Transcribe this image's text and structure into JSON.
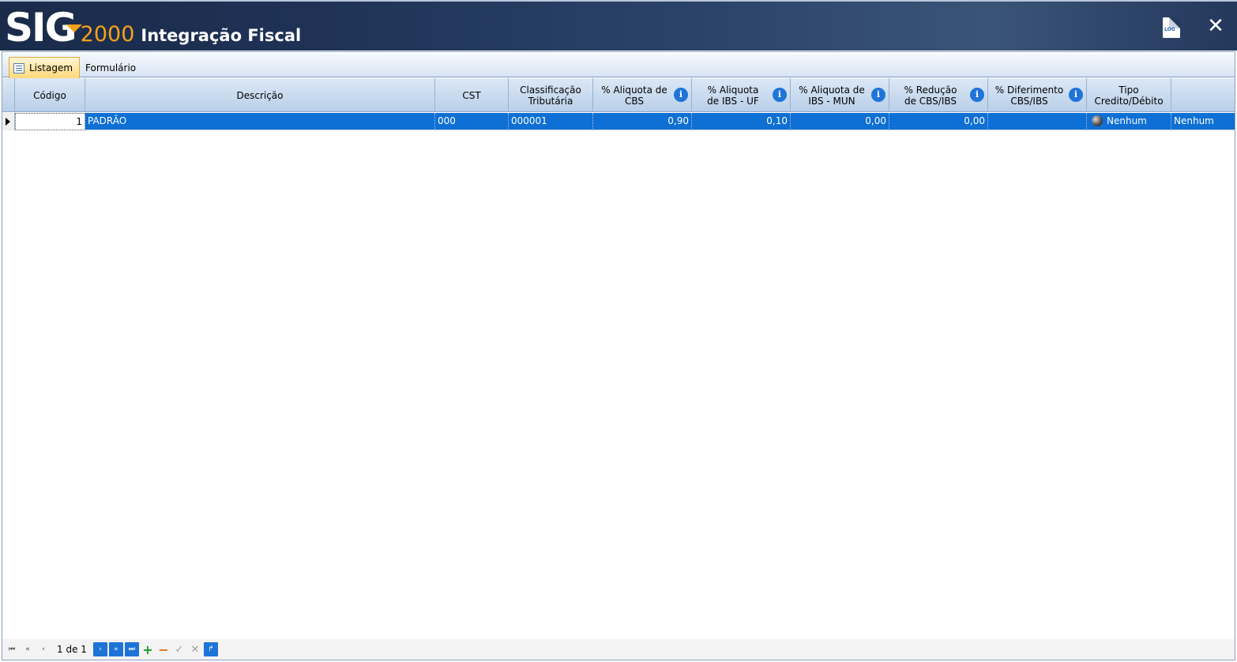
{
  "app": {
    "logo_main": "SIG",
    "logo_number": "2000",
    "title": "Integração Fiscal",
    "log_icon_label": "LOG"
  },
  "tabs": [
    {
      "label": "Listagem",
      "active": true
    },
    {
      "label": "Formulário",
      "active": false
    }
  ],
  "columns": [
    {
      "label": "Código"
    },
    {
      "label": "Descrição"
    },
    {
      "label": "CST"
    },
    {
      "label": "Classificação Tributária"
    },
    {
      "label": "% Aliquota de CBS"
    },
    {
      "label": "% Aliquota de IBS - UF"
    },
    {
      "label": "% Aliquota de IBS - MUN"
    },
    {
      "label": "% Redução de CBS/IBS"
    },
    {
      "label": "% Diferimento CBS/IBS"
    },
    {
      "label": "Tipo Credito/Débito"
    }
  ],
  "rows": [
    {
      "codigo": "1",
      "descricao": "PADRÃO",
      "cst": "000",
      "classificacao": "000001",
      "aliquota_cbs": "0,90",
      "aliquota_ibs_uf": "0,10",
      "aliquota_ibs_mun": "0,00",
      "reducao": "0,00",
      "diferimento": "",
      "tipo": "Nenhum",
      "extra": "Nenhum"
    }
  ],
  "navigator": {
    "record_info": "1 de 1",
    "first": "⏮",
    "prior_page": "«",
    "prior": "‹",
    "next": "›",
    "next_page": "»",
    "last": "⏭",
    "insert": "+",
    "delete": "−",
    "post": "✓",
    "cancel": "✕",
    "refresh": "↱"
  },
  "colors": {
    "title_bar": "#1f3256",
    "accent_orange": "#f5a21a",
    "selection": "#0e6fd4",
    "header_bg": "#c9daef",
    "info_icon": "#1f74d8"
  }
}
